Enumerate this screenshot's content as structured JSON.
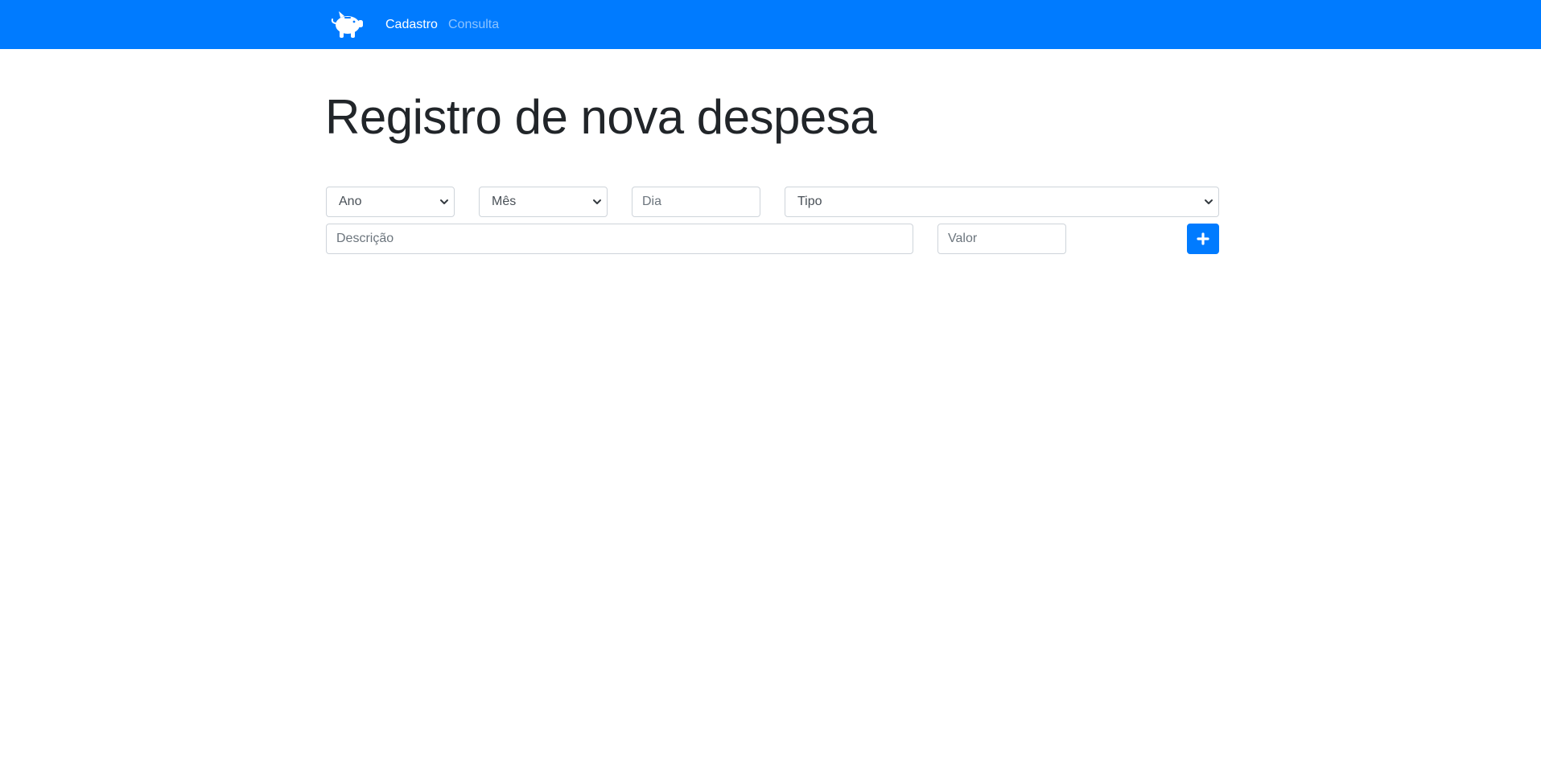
{
  "navbar": {
    "brand_icon": "piggy-bank-icon",
    "links": [
      {
        "label": "Cadastro",
        "active": true
      },
      {
        "label": "Consulta",
        "active": false
      }
    ],
    "background_color": "#007bff"
  },
  "page": {
    "title": "Registro de nova despesa"
  },
  "form": {
    "ano": {
      "selected": "Ano"
    },
    "mes": {
      "selected": "Mês"
    },
    "dia": {
      "placeholder": "Dia",
      "value": ""
    },
    "tipo": {
      "selected": "Tipo"
    },
    "descricao": {
      "placeholder": "Descrição",
      "value": ""
    },
    "valor": {
      "placeholder": "Valor",
      "value": ""
    },
    "add_button": {
      "icon": "plus-icon",
      "color": "#007bff"
    }
  }
}
